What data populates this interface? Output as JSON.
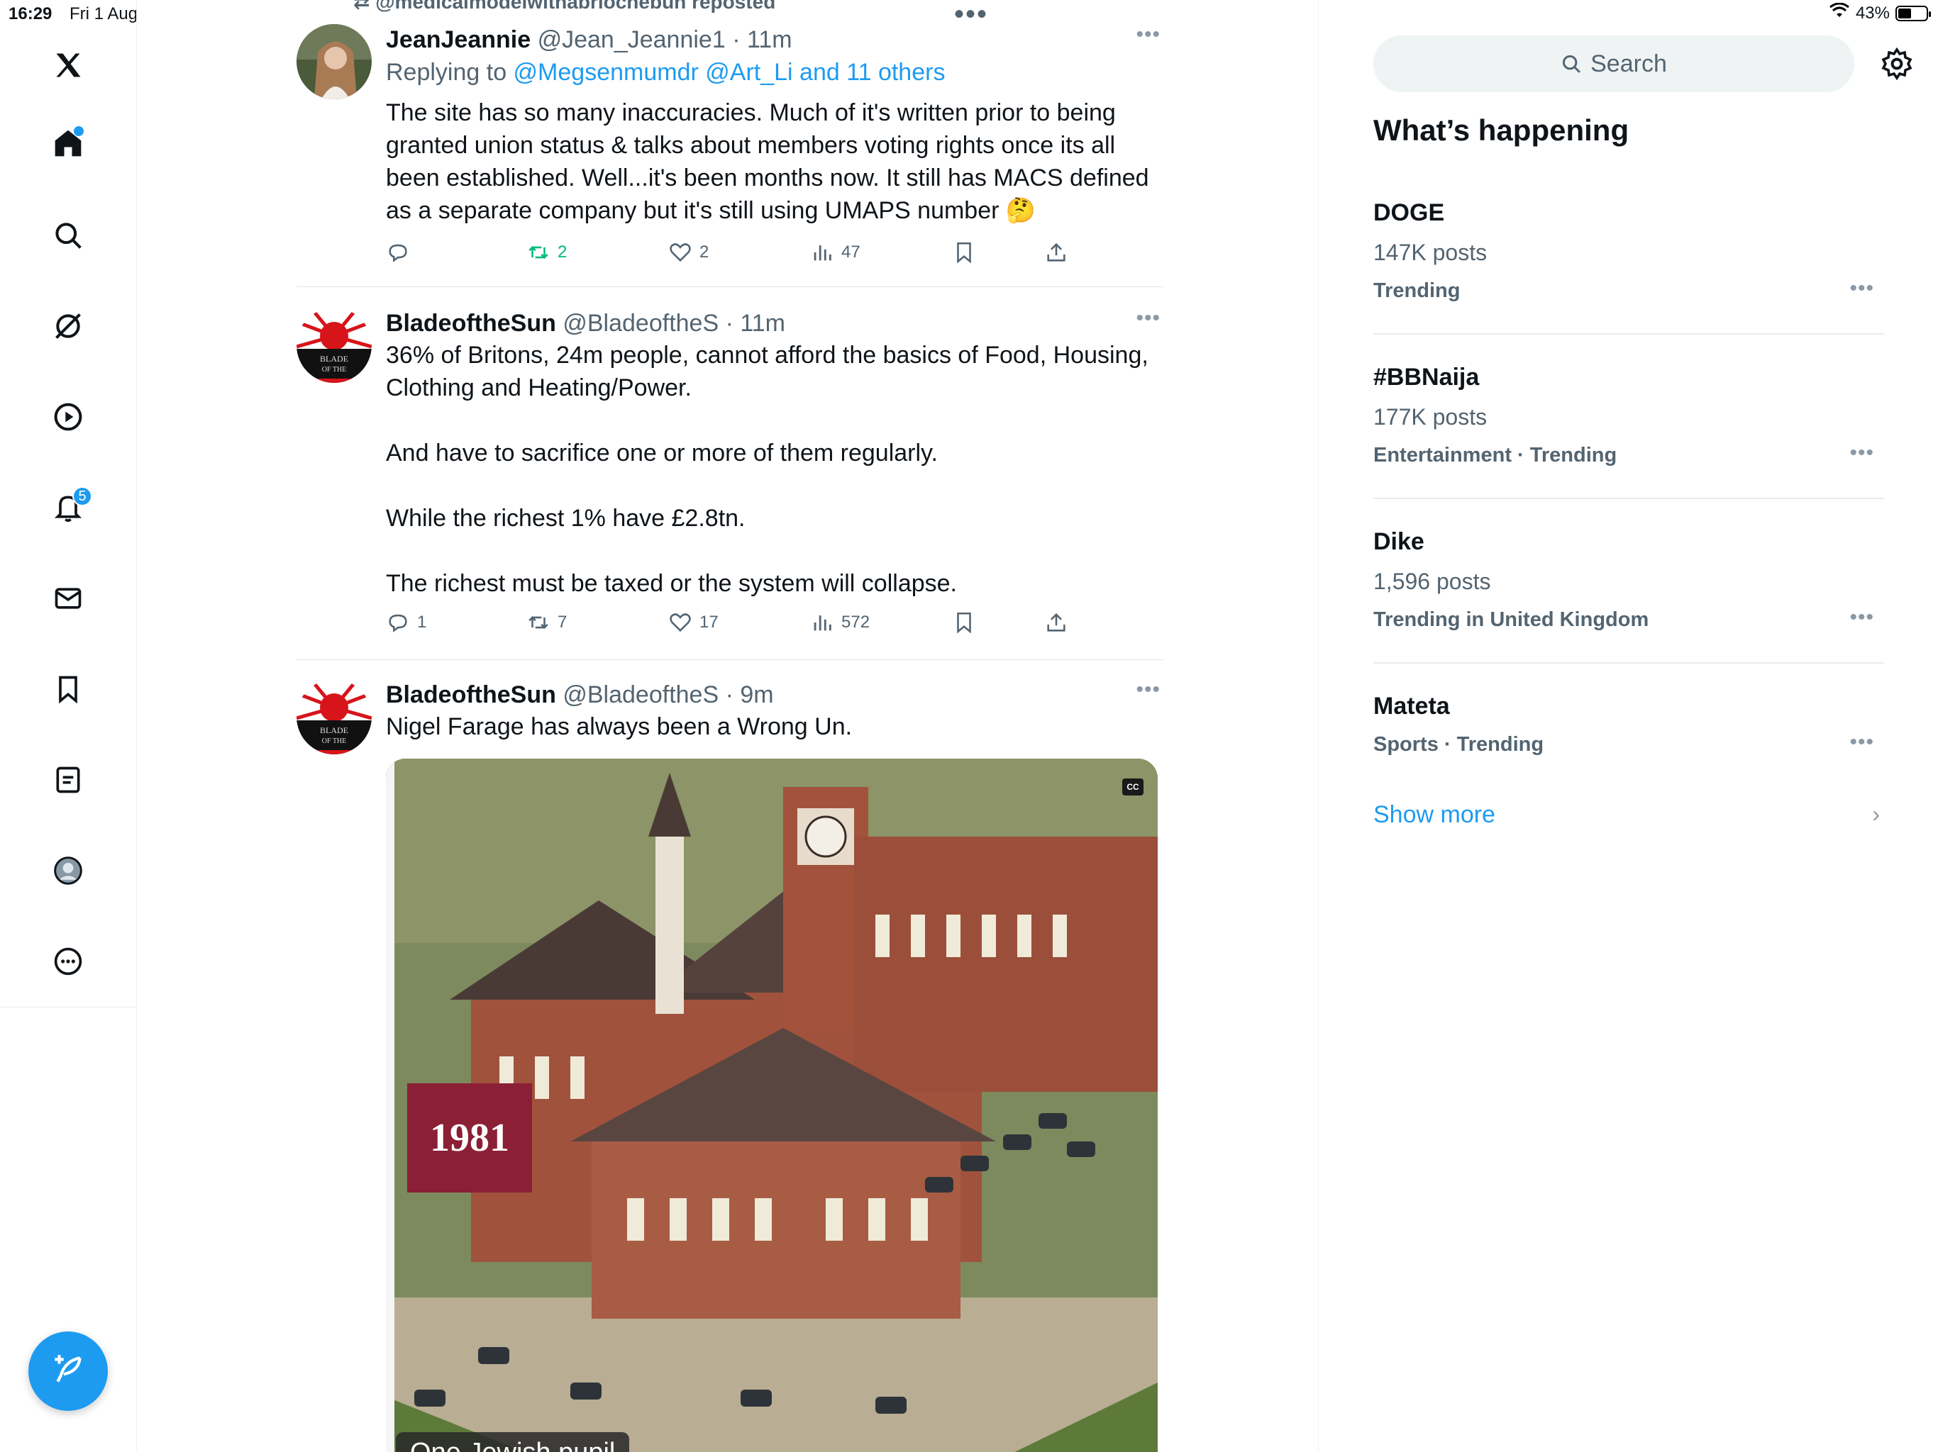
{
  "status_bar": {
    "time": "16:29",
    "date": "Fri 1 Aug",
    "battery": "43%",
    "battery_level": 0.43
  },
  "nav": {
    "notifications_badge": "5",
    "icons": [
      "x-logo-icon",
      "home-icon",
      "search-icon",
      "grok-icon",
      "video-icon",
      "notifications-icon",
      "messages-icon",
      "bookmarks-icon",
      "lists-icon",
      "profile-icon",
      "more-icon"
    ]
  },
  "feed": {
    "repost_header": "@medicalmodelwithabriochebun reposted",
    "tweets": [
      {
        "name": "JeanJeannie",
        "handle": "@Jean_Jeannie1",
        "time": "11m",
        "replying_prefix": "Replying to ",
        "replying_to": "@Megsenmumdr @Art_Li and 11 others",
        "text": "The site has so many inaccuracies. Much of it's written prior to being granted union status & talks about members voting rights once its all been established. Well...it's been months now. It still has MACS defined as a separate company but it's still using UMAPS number 🤔",
        "replies": "",
        "reposts": "2",
        "likes": "2",
        "views": "47"
      },
      {
        "name": "BladeoftheSun",
        "handle": "@BladeoftheS",
        "time": "11m",
        "text": "36% of Britons, 24m people, cannot afford the basics of Food, Housing, Clothing and Heating/Power.\n\nAnd have to sacrifice one or more of them regularly.\n\nWhile the richest 1% have £2.8tn.\n\nThe richest must be taxed or the system will collapse.",
        "replies": "1",
        "reposts": "7",
        "likes": "17",
        "views": "572"
      },
      {
        "name": "BladeoftheSun",
        "handle": "@BladeoftheS",
        "time": "9m",
        "text": "Nigel Farage has always been a Wrong Un.",
        "media_year": "1981",
        "media_cc": "CC",
        "media_caption": "One Jewish pupil"
      }
    ]
  },
  "sidebar": {
    "search_placeholder": "Search",
    "title": "What’s happening",
    "trends": [
      {
        "name": "DOGE",
        "count": "147K posts",
        "category": "Trending"
      },
      {
        "name": "#BBNaija",
        "count": "177K posts",
        "category": "Entertainment · Trending"
      },
      {
        "name": "Dike",
        "count": "1,596 posts",
        "category": "Trending in United Kingdom"
      },
      {
        "name": "Mateta",
        "count": "",
        "category": "Sports · Trending"
      }
    ],
    "show_more": "Show more"
  },
  "colors": {
    "accent": "#1d9bf0",
    "repost_green": "#00ba7c",
    "secondary_text": "#536471"
  }
}
